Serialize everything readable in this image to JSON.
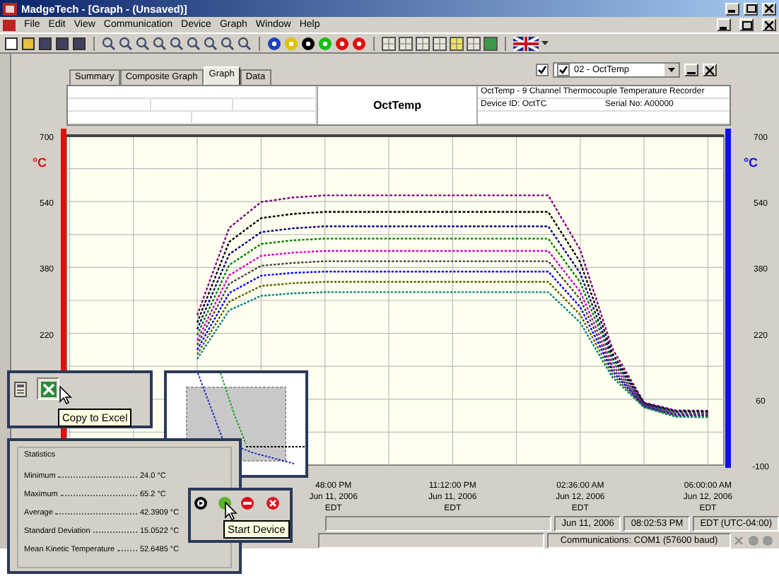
{
  "window": {
    "title": "MadgeTech - [Graph - (Unsaved)]"
  },
  "menu": [
    "File",
    "Edit",
    "View",
    "Communication",
    "Device",
    "Graph",
    "Window",
    "Help"
  ],
  "tabs": [
    {
      "label": "Summary",
      "selected": false
    },
    {
      "label": "Composite Graph",
      "selected": false
    },
    {
      "label": "Graph",
      "selected": true
    },
    {
      "label": "Data",
      "selected": false
    }
  ],
  "device_selector": {
    "checked": true,
    "item_checked": true,
    "value": "02 - OctTemp"
  },
  "header": {
    "title": "OctTemp",
    "description": "OctTemp - 9 Channel Thermocouple Temperature Recorder",
    "device_id": "Device ID: OctTC",
    "serial": "Serial No: A00000"
  },
  "graph": {
    "left_unit": "°C",
    "right_unit": "°C",
    "right_ticks": [
      "700",
      "540",
      "380",
      "220",
      "60",
      "-100"
    ],
    "chart_data": {
      "type": "line",
      "grid": true,
      "ylim": [
        -100,
        700
      ],
      "yticks": [
        220,
        380,
        540,
        700
      ],
      "categories": [
        null,
        null,
        null,
        null,
        null,
        null,
        null,
        null,
        "48:00 PM\nJun 11, 2006\nEDT",
        null,
        null,
        null,
        "11:12:00 PM\nJun 11, 2006\nEDT",
        null,
        null,
        null,
        "02:36:00 AM\nJun 12, 2006\nEDT",
        null,
        null,
        null,
        "06:00:00 AM\nJun 12, 2006\nEDT"
      ],
      "series": [
        {
          "color": "#800080",
          "line_style": "dotted",
          "values": [
            null,
            null,
            null,
            null,
            264,
            476,
            539,
            550,
            555,
            555,
            555,
            555,
            555,
            555,
            555,
            555,
            423,
            184,
            52,
            33,
            32
          ]
        },
        {
          "color": "#000000",
          "line_style": "dotted",
          "values": [
            null,
            null,
            null,
            null,
            246,
            442,
            500,
            510,
            515,
            515,
            515,
            515,
            515,
            515,
            515,
            515,
            393,
            172,
            50,
            31,
            30
          ]
        },
        {
          "color": "#000080",
          "line_style": "dotted",
          "values": [
            null,
            null,
            null,
            null,
            230,
            412,
            466,
            475,
            480,
            480,
            480,
            480,
            480,
            480,
            480,
            480,
            366,
            162,
            48,
            29,
            28
          ]
        },
        {
          "color": "#008000",
          "line_style": "dotted",
          "values": [
            null,
            null,
            null,
            null,
            216,
            386,
            437,
            446,
            450,
            450,
            450,
            450,
            450,
            450,
            450,
            450,
            344,
            153,
            46,
            27,
            26
          ]
        },
        {
          "color": "#cc00cc",
          "line_style": "dotted",
          "values": [
            null,
            null,
            null,
            null,
            203,
            361,
            408,
            416,
            420,
            420,
            420,
            420,
            420,
            420,
            420,
            420,
            321,
            144,
            45,
            25,
            24
          ]
        },
        {
          "color": "#404040",
          "line_style": "dotted",
          "values": [
            null,
            null,
            null,
            null,
            192,
            340,
            384,
            391,
            395,
            395,
            395,
            395,
            395,
            395,
            395,
            395,
            303,
            136,
            44,
            23,
            22
          ]
        },
        {
          "color": "#0000ff",
          "line_style": "dotted",
          "values": [
            null,
            null,
            null,
            null,
            180,
            318,
            360,
            367,
            370,
            370,
            370,
            370,
            370,
            370,
            370,
            370,
            284,
            129,
            42,
            21,
            20
          ]
        },
        {
          "color": "#606000",
          "line_style": "dotted",
          "values": [
            null,
            null,
            null,
            null,
            169,
            297,
            335,
            342,
            345,
            345,
            345,
            345,
            345,
            345,
            345,
            345,
            265,
            121,
            41,
            19,
            18
          ]
        },
        {
          "color": "#008080",
          "line_style": "dotted",
          "values": [
            null,
            null,
            null,
            null,
            158,
            276,
            311,
            317,
            320,
            320,
            320,
            320,
            320,
            320,
            320,
            320,
            246,
            114,
            40,
            17,
            16
          ]
        }
      ]
    }
  },
  "status_bar": {
    "date": "Jun 11, 2006",
    "time": "08:02:53 PM",
    "timezone": "EDT (UTC-04:00)",
    "communications": "Communications: COM1 (57600 baud)"
  },
  "excel_callout": {
    "tooltip": "Copy to Excel"
  },
  "statistics": {
    "title": "Statistics",
    "rows": [
      {
        "label": "Minimum",
        "value": "24.0 °C"
      },
      {
        "label": "Maximum",
        "value": "65.2 °C"
      },
      {
        "label": "Average",
        "value": "42.3909 °C"
      },
      {
        "label": "Standard Deviation",
        "value": "15.0522 °C"
      },
      {
        "label": "Mean Kinetic Temperature",
        "value": "52.6485 °C"
      }
    ]
  },
  "device_callout": {
    "tooltip": "Start Device"
  }
}
